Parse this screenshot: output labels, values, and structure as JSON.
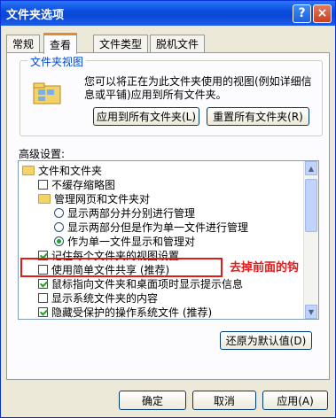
{
  "window": {
    "title": "文件夹选项",
    "help": "?",
    "close": "×"
  },
  "tabs": [
    "常规",
    "查看",
    "文件类型",
    "脱机文件"
  ],
  "folder_views": {
    "title": "文件夹视图",
    "description": "您可以将正在为此文件夹使用的视图(例如详细信息或平铺)应用到所有文件夹。",
    "apply_all": "应用到所有文件夹(L)",
    "reset_all": "重置所有文件夹(R)"
  },
  "advanced": {
    "label": "高级设置:",
    "items": [
      {
        "type": "folder",
        "label": "文件和文件夹",
        "level": 0
      },
      {
        "type": "check",
        "label": "不缓存缩略图",
        "checked": false,
        "level": 1
      },
      {
        "type": "folder",
        "label": "管理网页和文件夹对",
        "level": 1
      },
      {
        "type": "radio",
        "label": "显示两部分并分别进行管理",
        "checked": false,
        "level": 2
      },
      {
        "type": "radio",
        "label": "显示两部分但是作为单一文件进行管理",
        "checked": false,
        "level": 2
      },
      {
        "type": "radio",
        "label": "作为单一文件显示和管理对",
        "checked": true,
        "level": 2
      },
      {
        "type": "check",
        "label": "记住每个文件夹的视图设置",
        "checked": true,
        "level": 1
      },
      {
        "type": "check",
        "label": "使用简单文件共享 (推荐)",
        "checked": false,
        "level": 1
      },
      {
        "type": "check",
        "label": "鼠标指向文件夹和桌面项时显示提示信息",
        "checked": true,
        "level": 1
      },
      {
        "type": "check",
        "label": "显示系统文件夹的内容",
        "checked": false,
        "level": 1
      },
      {
        "type": "check",
        "label": "隐藏受保护的操作系统文件 (推荐)",
        "checked": true,
        "level": 1
      }
    ],
    "restore_defaults": "还原为默认值(D)"
  },
  "annotation": "去掉前面的钩",
  "footer": {
    "ok": "确定",
    "cancel": "取消",
    "apply": "应用(A)"
  }
}
